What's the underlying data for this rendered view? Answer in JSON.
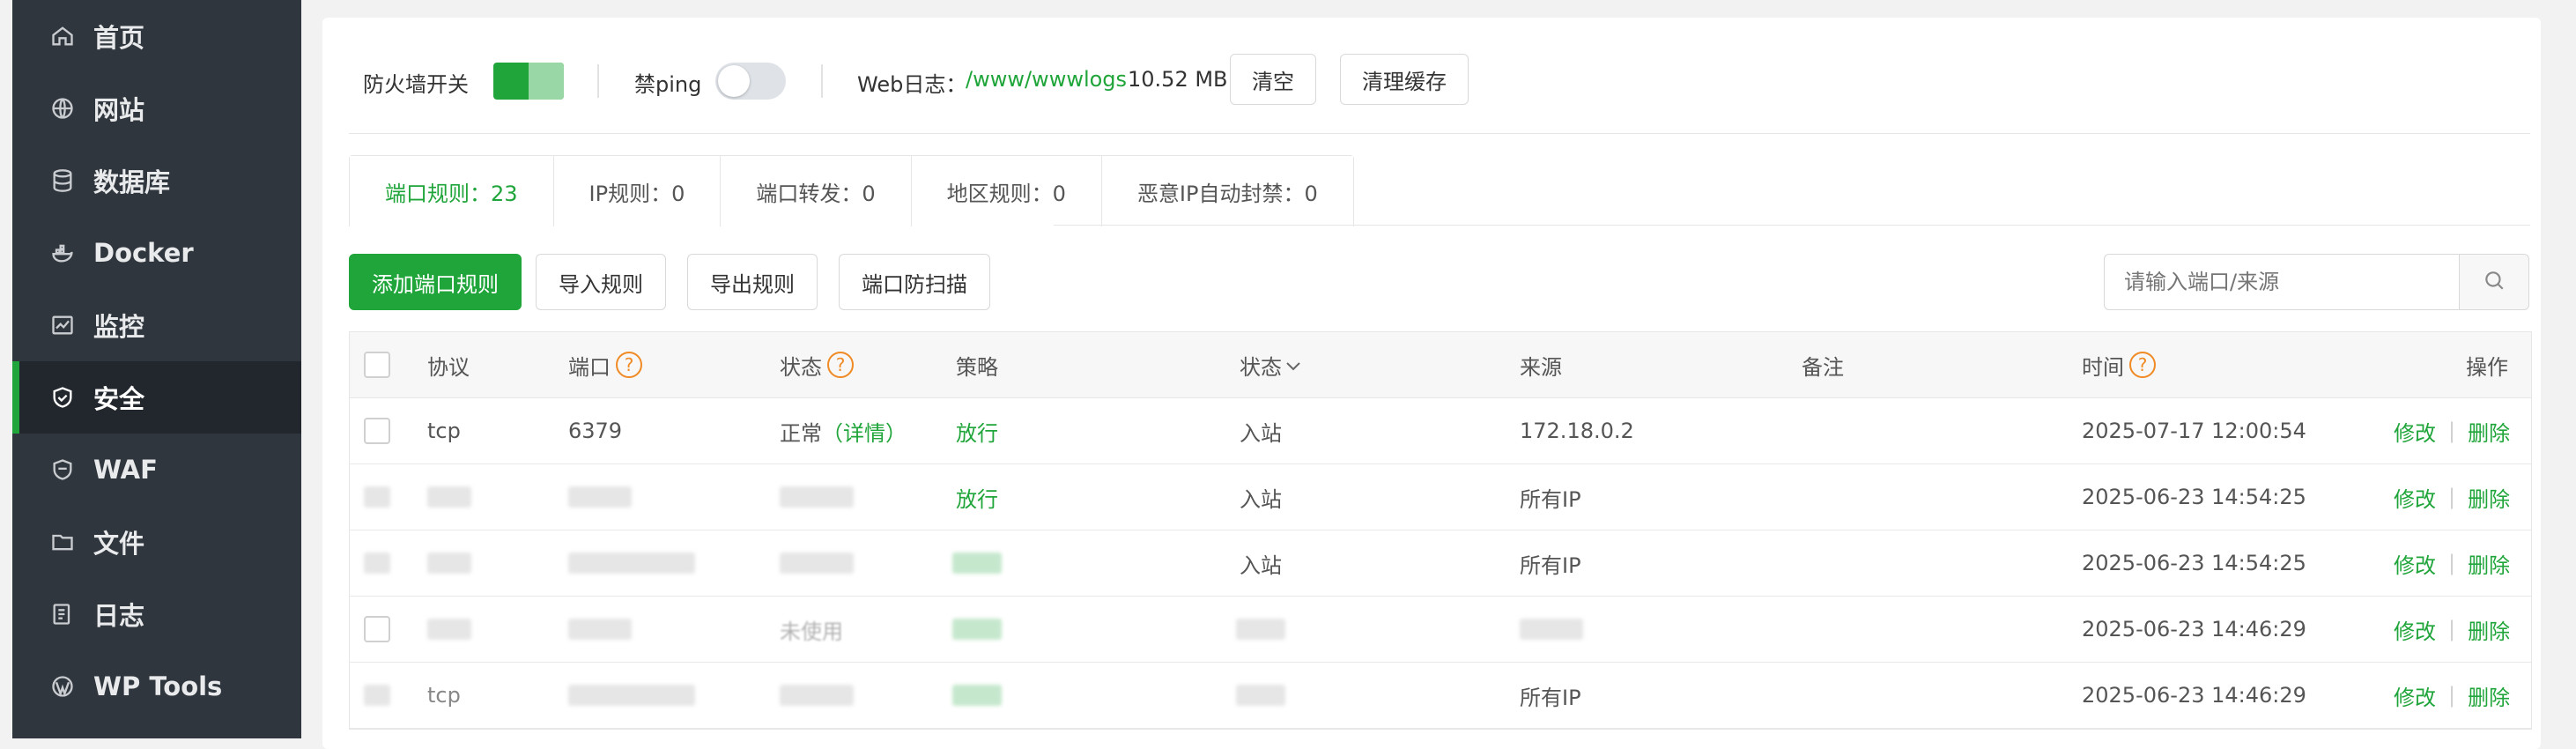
{
  "sidebar": {
    "items": [
      {
        "label": "首页",
        "icon": "home-icon"
      },
      {
        "label": "网站",
        "icon": "globe-icon"
      },
      {
        "label": "数据库",
        "icon": "database-icon"
      },
      {
        "label": "Docker",
        "icon": "docker-icon"
      },
      {
        "label": "监控",
        "icon": "monitor-icon"
      },
      {
        "label": "安全",
        "icon": "shield-icon",
        "active": true
      },
      {
        "label": "WAF",
        "icon": "waf-shield-icon"
      },
      {
        "label": "文件",
        "icon": "folder-icon"
      },
      {
        "label": "日志",
        "icon": "log-icon"
      },
      {
        "label": "WP Tools",
        "icon": "wordpress-icon"
      }
    ]
  },
  "toolbar": {
    "firewall_label": "防火墙开关",
    "firewall_on": true,
    "ping_label": "禁ping",
    "ping_on": false,
    "weblog_label": "Web日志：",
    "weblog_path": "/www/wwwlogs",
    "weblog_size": "10.52 MB",
    "clear_label": "清空",
    "clear_cache_label": "清理缓存"
  },
  "tabs": [
    {
      "label": "端口规则：23",
      "active": true
    },
    {
      "label": "IP规则：0"
    },
    {
      "label": "端口转发：0"
    },
    {
      "label": "地区规则：0"
    },
    {
      "label": "恶意IP自动封禁：0"
    }
  ],
  "actions": {
    "add_label": "添加端口规则",
    "import_label": "导入规则",
    "export_label": "导出规则",
    "scan_label": "端口防扫描",
    "search_placeholder": "请输入端口/来源"
  },
  "table": {
    "headers": {
      "protocol": "协议",
      "port": "端口",
      "status": "状态",
      "strategy": "策略",
      "direction": "状态",
      "source": "来源",
      "remark": "备注",
      "time": "时间",
      "ops": "操作"
    },
    "rows": [
      {
        "protocol": "tcp",
        "port": "6379",
        "status": "正常",
        "detail": "（详情）",
        "strategy": "放行",
        "direction": "入站",
        "source": "172.18.0.2",
        "time": "2025-07-17 12:00:54",
        "edit": "修改",
        "delete": "删除"
      },
      {
        "protocol": "",
        "port": "",
        "status": "",
        "detail": "",
        "strategy": "放行",
        "direction": "入站",
        "source": "所有IP",
        "time": "2025-06-23 14:54:25",
        "edit": "修改",
        "delete": "删除"
      },
      {
        "protocol": "",
        "port": "",
        "status": "",
        "detail": "",
        "strategy": "",
        "direction": "入站",
        "source": "所有IP",
        "time": "2025-06-23 14:54:25",
        "edit": "修改",
        "delete": "删除"
      },
      {
        "protocol": "",
        "port": "",
        "status": "未使用",
        "detail": "",
        "strategy": "",
        "direction": "",
        "source": "",
        "time": "2025-06-23 14:46:29",
        "edit": "修改",
        "delete": "删除"
      },
      {
        "protocol": "tcp",
        "port": "",
        "status": "",
        "detail": "",
        "strategy": "",
        "direction": "",
        "source": "所有IP",
        "time": "2025-06-23 14:46:29",
        "edit": "修改",
        "delete": "删除"
      }
    ]
  },
  "colors": {
    "accent": "#20a53a",
    "sidebar_bg": "#30363d",
    "help": "#f08a24"
  }
}
